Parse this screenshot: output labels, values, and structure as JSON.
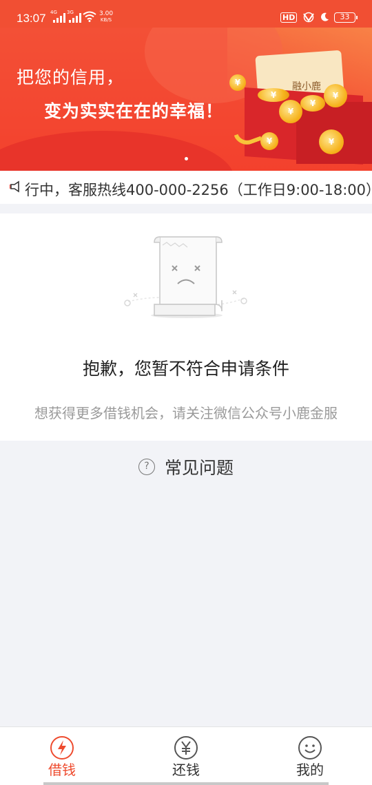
{
  "status_bar": {
    "time": "13:07",
    "net1": "4G",
    "net2": "3G",
    "speed_value": "3.00",
    "speed_unit": "KB/S",
    "hd_label": "HD",
    "battery": "33"
  },
  "banner": {
    "line1": "把您的信用，",
    "line2": "变为实实在在的幸福！",
    "card_label": "融小鹿",
    "coin_symbol": "¥",
    "accent_color": "#f14f33"
  },
  "marquee": {
    "text": "行中，客服热线400-000-2256（工作日9:00-18:00）"
  },
  "notice": {
    "title": "抱歉，您暂不符合申请条件",
    "subtitle": "想获得更多借钱机会，请关注微信公众号小鹿金服"
  },
  "faq": {
    "icon_glyph": "?",
    "title": "常见问题"
  },
  "tabs": [
    {
      "label": "借钱",
      "icon": "lightning-icon",
      "active": true
    },
    {
      "label": "还钱",
      "icon": "yen-icon",
      "active": false
    },
    {
      "label": "我的",
      "icon": "smiley-icon",
      "active": false
    }
  ],
  "active_tab_color": "#ee4b2e"
}
